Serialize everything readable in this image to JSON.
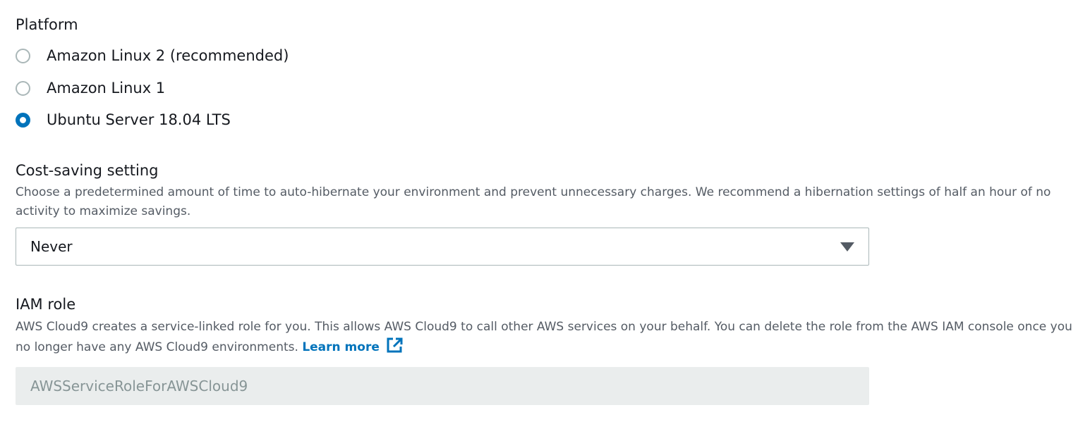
{
  "platform": {
    "label": "Platform",
    "options": [
      {
        "label": "Amazon Linux 2 (recommended)",
        "selected": false
      },
      {
        "label": "Amazon Linux 1",
        "selected": false
      },
      {
        "label": "Ubuntu Server 18.04 LTS",
        "selected": true
      }
    ]
  },
  "cost_saving": {
    "label": "Cost-saving setting",
    "description": "Choose a predetermined amount of time to auto-hibernate your environment and prevent unnecessary charges. We recommend a hibernation settings of half an hour of no activity to maximize savings.",
    "selected_value": "Never"
  },
  "iam_role": {
    "label": "IAM role",
    "description": "AWS Cloud9 creates a service-linked role for you. This allows AWS Cloud9 to call other AWS services on your behalf. You can delete the role from the AWS IAM console once you no longer have any AWS Cloud9 environments.",
    "learn_more": "Learn more",
    "value": "AWSServiceRoleForAWSCloud9"
  },
  "colors": {
    "accent": "#0073bb",
    "text": "#16191f",
    "secondary_text": "#545b64",
    "disabled_bg": "#eaeded",
    "disabled_text": "#879596"
  },
  "icons": {
    "external_link": "external-link-icon",
    "dropdown": "caret-down-icon"
  }
}
